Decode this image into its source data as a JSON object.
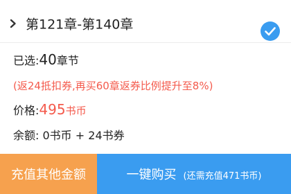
{
  "chapter_picker": {
    "range_label": "第121章-第140章",
    "expand_icon": "chevron-right-icon",
    "selected_icon": "check-circle-icon",
    "selected": true
  },
  "selection": {
    "label": "已选:",
    "count": "40",
    "unit": "章节"
  },
  "promo_note": "(返24抵扣券,再买60章返券比例提升至8%)",
  "price": {
    "label": "价格:",
    "amount": "495",
    "unit": "书币"
  },
  "balance": {
    "label": "余额:",
    "value": "0书币 + 24书券"
  },
  "actions": {
    "recharge_label": "充值其他金额",
    "buy_label": "一键购买",
    "buy_note": "(还需充值471书币)"
  },
  "colors": {
    "accent_blue": "#3a9cf0",
    "accent_orange": "#f6a14e",
    "highlight_red": "#f45a4c"
  }
}
